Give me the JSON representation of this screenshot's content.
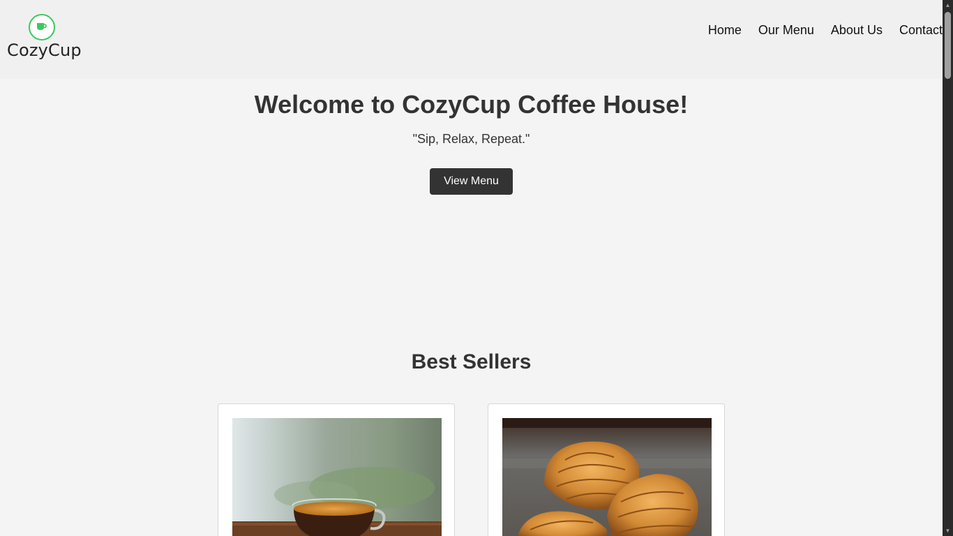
{
  "brand": {
    "name": "CozyCup",
    "logo_icon": "coffee-cup-icon",
    "accent_color": "#3cc85c"
  },
  "nav": {
    "items": [
      {
        "label": "Home"
      },
      {
        "label": "Our Menu"
      },
      {
        "label": "About Us"
      },
      {
        "label": "Contact"
      }
    ]
  },
  "hero": {
    "title": "Welcome to CozyCup Coffee House!",
    "tagline": "\"Sip, Relax, Repeat.\"",
    "button_label": "View Menu"
  },
  "best_sellers": {
    "title": "Best Sellers",
    "products": [
      {
        "image": "espresso-cup-photo"
      },
      {
        "image": "croissants-photo"
      }
    ]
  }
}
